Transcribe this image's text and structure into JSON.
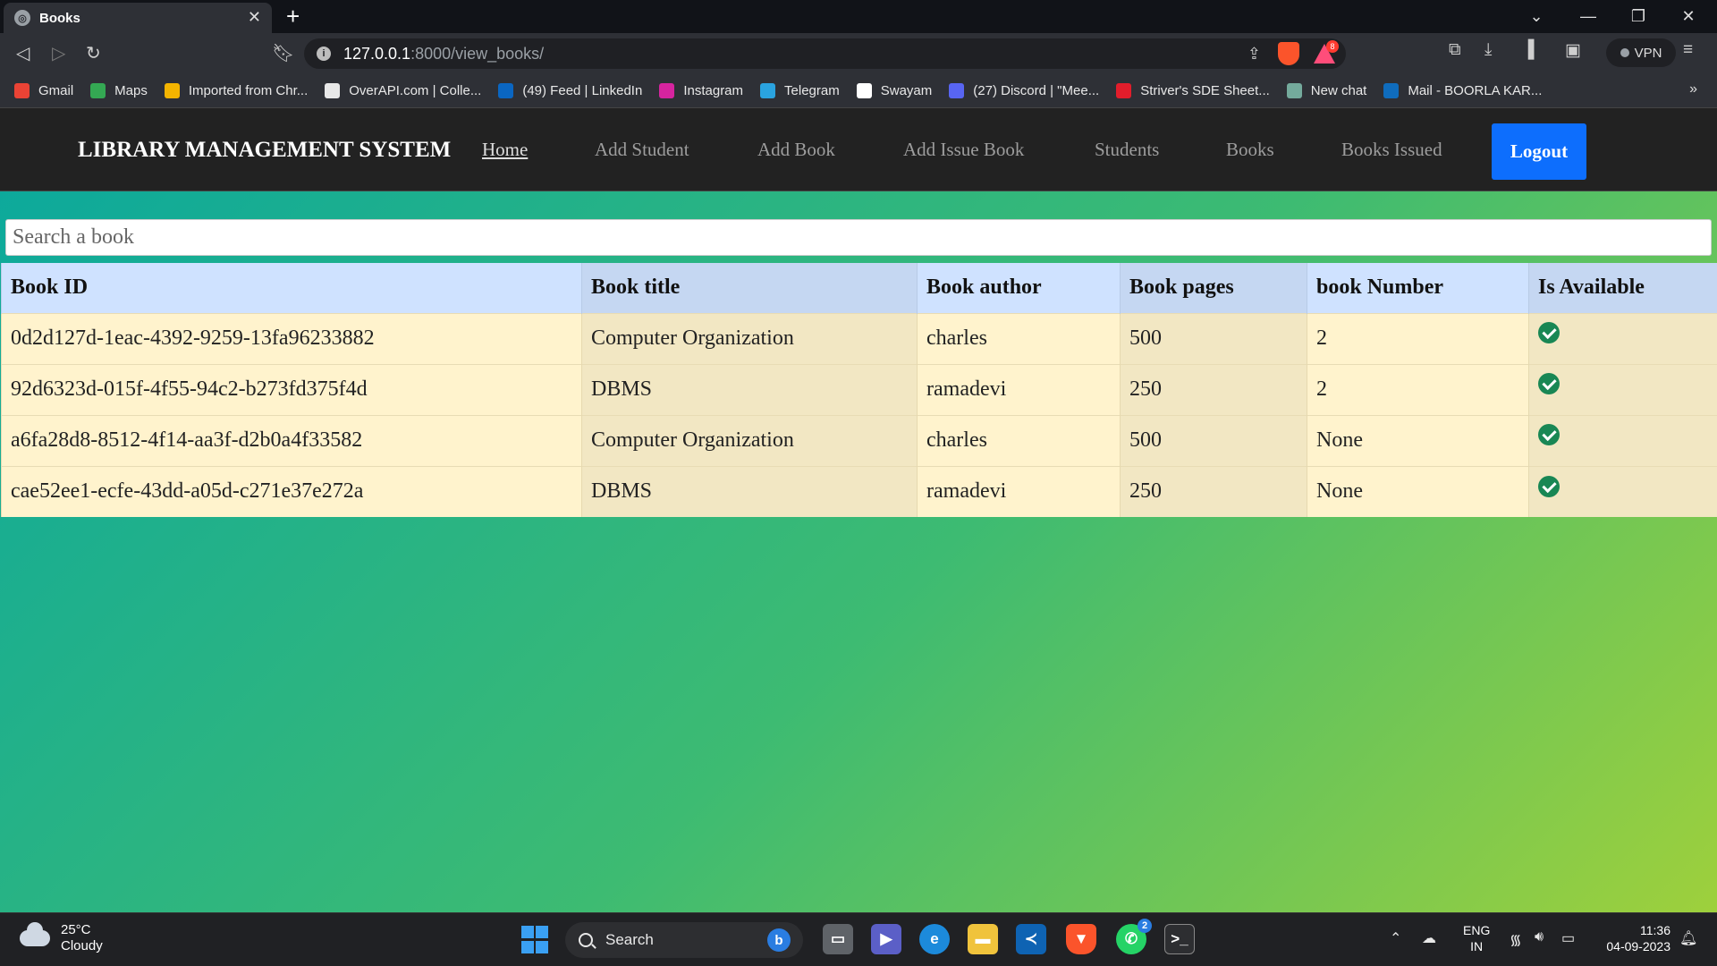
{
  "browser": {
    "tab_title": "Books",
    "url_host": "127.0.0.1",
    "url_path": ":8000/view_books/",
    "rewards_count": "8",
    "vpn_label": "VPN",
    "bookmarks": [
      {
        "label": "Gmail",
        "icon": "gmail-icon",
        "color": "#ea4335"
      },
      {
        "label": "Maps",
        "icon": "maps-icon",
        "color": "#34a853"
      },
      {
        "label": "Imported from Chr...",
        "icon": "folder-icon",
        "color": "#f4b400"
      },
      {
        "label": "OverAPI.com | Colle...",
        "icon": "overapi-icon",
        "color": "#e8e8e8"
      },
      {
        "label": "(49) Feed | LinkedIn",
        "icon": "linkedin-icon",
        "color": "#0a66c2"
      },
      {
        "label": "Instagram",
        "icon": "instagram-icon",
        "color": "#d6249f"
      },
      {
        "label": "Telegram",
        "icon": "telegram-icon",
        "color": "#2aa3df"
      },
      {
        "label": "Swayam",
        "icon": "google-icon",
        "color": "#ffffff"
      },
      {
        "label": "(27) Discord | \"Mee...",
        "icon": "discord-icon",
        "color": "#5865f2"
      },
      {
        "label": "Striver's SDE Sheet...",
        "icon": "tuf-icon",
        "color": "#e21d2b"
      },
      {
        "label": "New chat",
        "icon": "chatgpt-icon",
        "color": "#74aa9c"
      },
      {
        "label": "Mail - BOORLA KAR...",
        "icon": "outlook-icon",
        "color": "#0f6cbd"
      }
    ]
  },
  "navbar": {
    "brand": "LIBRARY MANAGEMENT SYSTEM",
    "links": [
      "Home",
      "Add Student",
      "Add Book",
      "Add Issue Book",
      "Students",
      "Books",
      "Books Issued"
    ],
    "logout": "Logout"
  },
  "search": {
    "placeholder": "Search a book"
  },
  "table": {
    "headers": [
      "Book ID",
      "Book title",
      "Book author",
      "Book pages",
      "book Number",
      "Is Available"
    ],
    "rows": [
      {
        "id": "0d2d127d-1eac-4392-9259-13fa96233882",
        "title": "Computer Organization",
        "author": "charles",
        "pages": "500",
        "number": "2",
        "available": true
      },
      {
        "id": "92d6323d-015f-4f55-94c2-b273fd375f4d",
        "title": "DBMS",
        "author": "ramadevi",
        "pages": "250",
        "number": "2",
        "available": true
      },
      {
        "id": "a6fa28d8-8512-4f14-aa3f-d2b0a4f33582",
        "title": "Computer Organization",
        "author": "charles",
        "pages": "500",
        "number": "None",
        "available": true
      },
      {
        "id": "cae52ee1-ecfe-43dd-a05d-c271e37e272a",
        "title": "DBMS",
        "author": "ramadevi",
        "pages": "250",
        "number": "None",
        "available": true
      }
    ]
  },
  "taskbar": {
    "temperature": "25°C",
    "weather": "Cloudy",
    "search_label": "Search",
    "whatsapp_badge": "2",
    "lang_top": "ENG",
    "lang_bottom": "IN",
    "time": "11:36",
    "date": "04-09-2023"
  }
}
